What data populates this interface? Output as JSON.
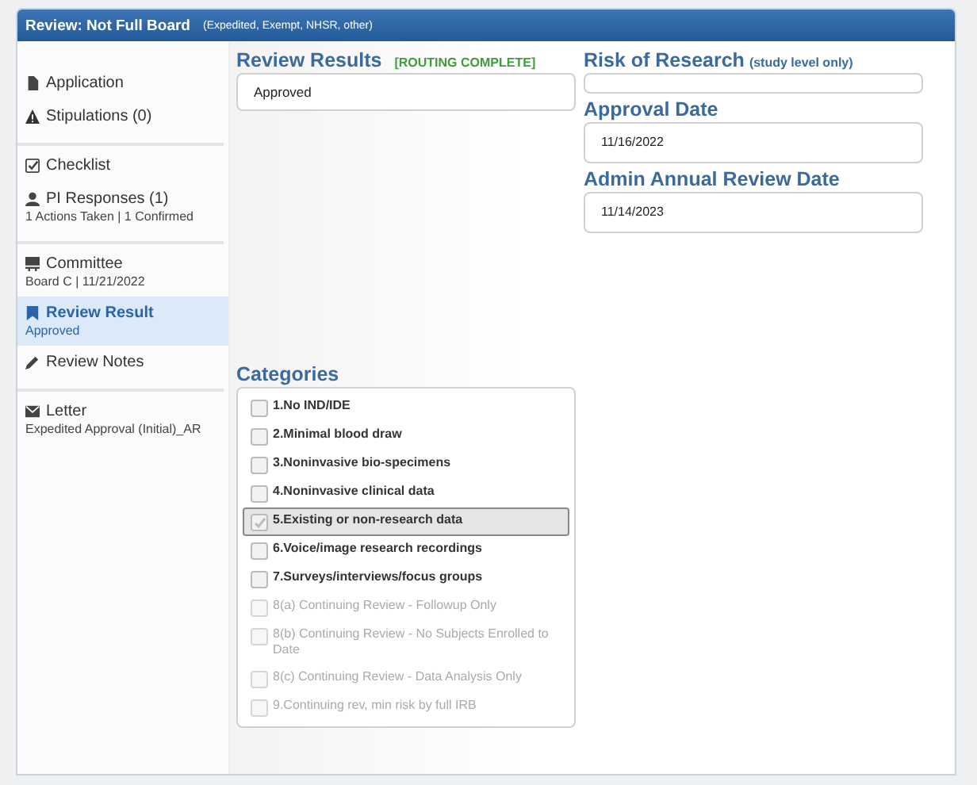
{
  "window": {
    "title": "Review: Not Full Board",
    "subtitle": "(Expedited, Exempt, NHSR, other)"
  },
  "sidebar": {
    "groups": [
      [
        {
          "kind": "document",
          "label": "Application",
          "selected": false
        },
        {
          "kind": "warning",
          "label": "Stipulations (0)",
          "selected": false
        }
      ],
      [
        {
          "kind": "checklist",
          "label": "Checklist",
          "selected": false
        },
        {
          "kind": "person",
          "label": "PI Responses (1)",
          "sub": "1 Actions Taken | 1 Confirmed",
          "selected": false
        }
      ],
      [
        {
          "kind": "board",
          "label": "Committee",
          "sub": "Board C | 11/21/2022",
          "selected": false
        },
        {
          "kind": "bookmark",
          "label": "Review Result",
          "sub": "Approved",
          "selected": true
        },
        {
          "kind": "pencil",
          "label": "Review Notes",
          "selected": false
        }
      ],
      [
        {
          "kind": "envelope",
          "label": "Letter",
          "sub": "Expedited Approval (Initial)_AR",
          "selected": false
        }
      ]
    ]
  },
  "review_results": {
    "heading": "Review Results",
    "status": "[ROUTING COMPLETE]",
    "value": "Approved"
  },
  "risk_of_research": {
    "heading": "Risk of Research",
    "note": "(study level only)"
  },
  "approval_date": {
    "heading": "Approval Date",
    "value": "11/16/2022"
  },
  "admin_annual_review_date": {
    "heading": "Admin Annual Review Date",
    "value": "11/14/2023"
  },
  "categories": {
    "heading": "Categories",
    "items": [
      {
        "label": "1.No IND/IDE",
        "checked": false,
        "disabled": false,
        "selected": false
      },
      {
        "label": "2.Minimal blood draw",
        "checked": false,
        "disabled": false,
        "selected": false
      },
      {
        "label": "3.Noninvasive bio-specimens",
        "checked": false,
        "disabled": false,
        "selected": false
      },
      {
        "label": "4.Noninvasive clinical data",
        "checked": false,
        "disabled": false,
        "selected": false
      },
      {
        "label": "5.Existing or non-research data",
        "checked": true,
        "disabled": false,
        "selected": true
      },
      {
        "label": "6.Voice/image research recordings",
        "checked": false,
        "disabled": false,
        "selected": false
      },
      {
        "label": "7.Surveys/interviews/focus groups",
        "checked": false,
        "disabled": false,
        "selected": false
      },
      {
        "label": "8(a) Continuing Review - Followup Only",
        "checked": false,
        "disabled": true,
        "selected": false
      },
      {
        "label": "8(b) Continuing Review - No Subjects Enrolled to Date",
        "checked": false,
        "disabled": true,
        "selected": false
      },
      {
        "label": "8(c) Continuing Review - Data Analysis Only",
        "checked": false,
        "disabled": true,
        "selected": false
      },
      {
        "label": "9.Continuing rev, min risk by full IRB",
        "checked": false,
        "disabled": true,
        "selected": false
      }
    ]
  }
}
